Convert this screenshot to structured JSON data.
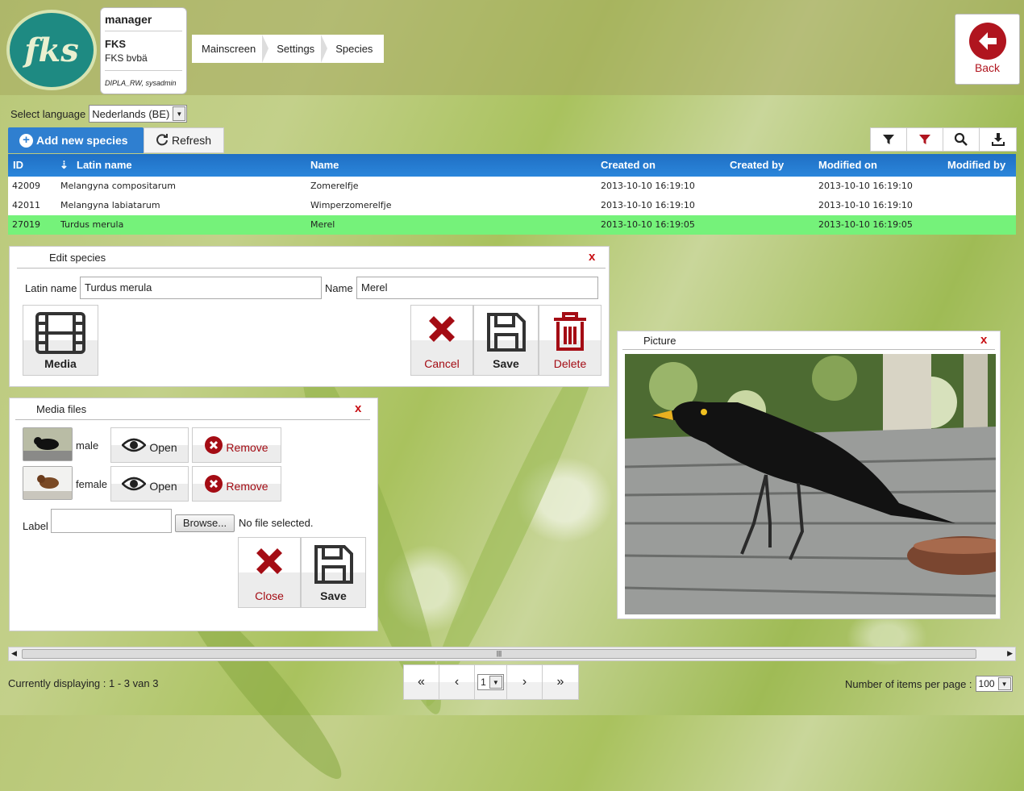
{
  "header": {
    "logo_text": "fks",
    "user": {
      "name": "manager",
      "company": "FKS",
      "company_full": "FKS bvbä",
      "roles": "DIPLA_RW, sysadmin"
    },
    "breadcrumb": [
      "Mainscreen",
      "Settings",
      "Species"
    ],
    "back_label": "Back"
  },
  "language": {
    "label": "Select language",
    "selected": "Nederlands (BE)"
  },
  "toolbar": {
    "add_label": "Add new species",
    "refresh_label": "Refresh"
  },
  "grid": {
    "columns": [
      "ID",
      "Latin name",
      "Name",
      "Created on",
      "Created by",
      "Modified on",
      "Modified by"
    ],
    "rows": [
      {
        "id": "42009",
        "latin": "Melangyna compositarum",
        "name": "Zomerelfje",
        "created_on": "2013-10-10 16:19:10",
        "created_by": "",
        "modified_on": "2013-10-10 16:19:10",
        "modified_by": ""
      },
      {
        "id": "42011",
        "latin": "Melangyna labiatarum",
        "name": "Wimperzomerelfje",
        "created_on": "2013-10-10 16:19:10",
        "created_by": "",
        "modified_on": "2013-10-10 16:19:10",
        "modified_by": ""
      },
      {
        "id": "27019",
        "latin": "Turdus merula",
        "name": "Merel",
        "created_on": "2013-10-10 16:19:05",
        "created_by": "",
        "modified_on": "2013-10-10 16:19:05",
        "modified_by": ""
      }
    ]
  },
  "edit_panel": {
    "title": "Edit species",
    "close": "x",
    "latin_label": "Latin name",
    "latin_value": "Turdus merula",
    "name_label": "Name",
    "name_value": "Merel",
    "media_label": "Media",
    "cancel_label": "Cancel",
    "save_label": "Save",
    "delete_label": "Delete"
  },
  "media_panel": {
    "title": "Media files",
    "close": "x",
    "files": [
      {
        "label": "male",
        "open": "Open",
        "remove": "Remove"
      },
      {
        "label": "female",
        "open": "Open",
        "remove": "Remove"
      }
    ],
    "label_field": "Label",
    "browse": "Browse...",
    "no_file": "No file selected.",
    "close_label": "Close",
    "save_label": "Save"
  },
  "picture_panel": {
    "title": "Picture",
    "close": "x"
  },
  "footer": {
    "display_text": "Currently displaying : 1 - 3 van 3",
    "page": "1",
    "items_label": "Number of items per page :",
    "items_value": "100"
  },
  "colors": {
    "accent_blue": "#2f7fd0",
    "selected_row": "#75f27a",
    "danger_red": "#a40c14"
  },
  "icons": [
    "fks-logo",
    "back-arrow-icon",
    "plus-icon",
    "refresh-icon",
    "filter-icon",
    "filter-clear-icon",
    "search-icon",
    "download-icon",
    "sort-icon",
    "film-icon",
    "x-icon",
    "save-icon",
    "trash-icon",
    "eye-icon",
    "remove-icon",
    "first-page-icon",
    "prev-page-icon",
    "next-page-icon",
    "last-page-icon"
  ]
}
